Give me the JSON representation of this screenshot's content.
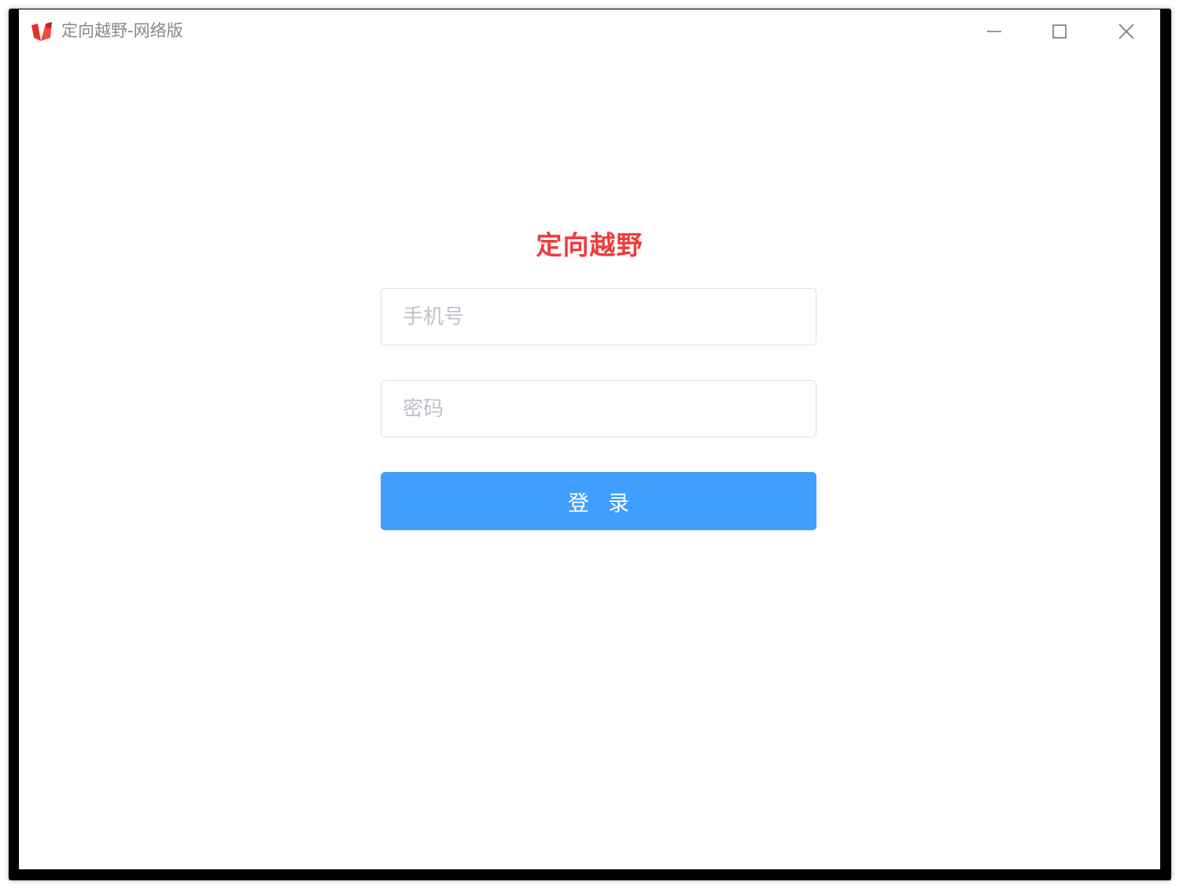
{
  "window": {
    "title": "定向越野-网络版",
    "logo_icon": "app-logo-icon",
    "controls": {
      "minimize_icon": "minimize-icon",
      "maximize_icon": "maximize-icon",
      "close_icon": "close-icon"
    }
  },
  "login": {
    "title": "定向越野",
    "phone_placeholder": "手机号",
    "phone_value": "",
    "password_placeholder": "密码",
    "password_value": "",
    "submit_label": "登录"
  },
  "colors": {
    "title_red": "#f03a3a",
    "button_blue": "#409eff",
    "input_border": "#dcdfe6",
    "placeholder_gray": "#bfc2c9"
  }
}
